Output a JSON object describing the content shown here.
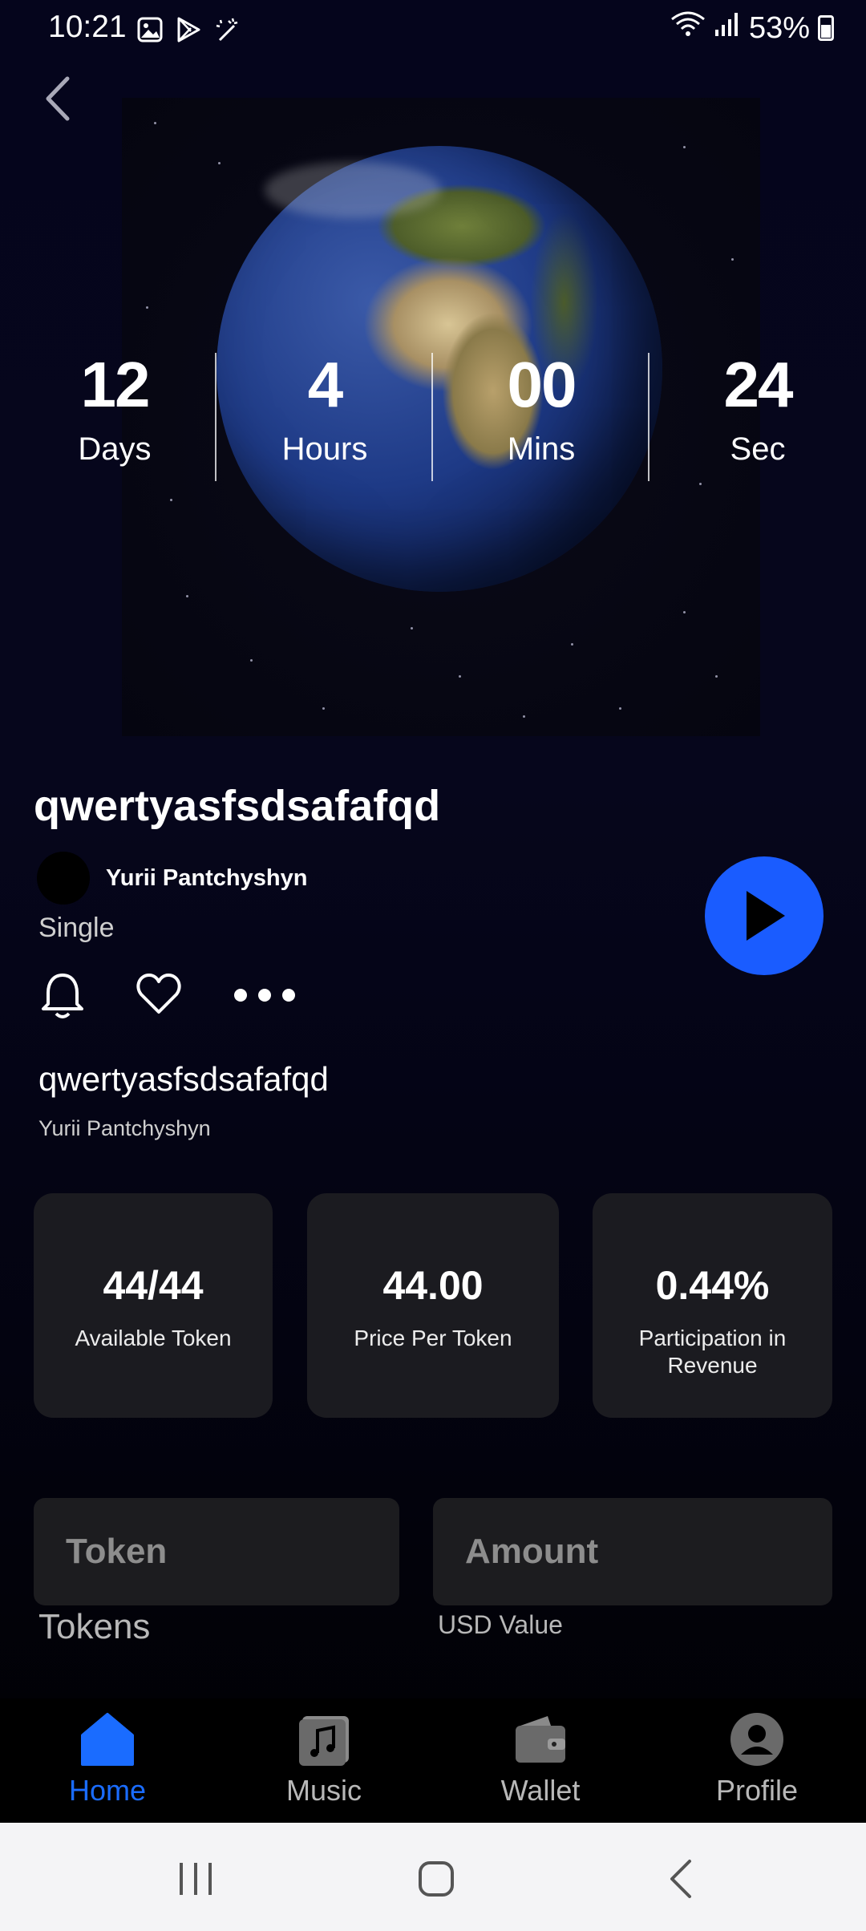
{
  "status": {
    "time": "10:21",
    "battery": "53%"
  },
  "countdown": [
    {
      "value": "12",
      "label": "Days"
    },
    {
      "value": "4",
      "label": "Hours"
    },
    {
      "value": "00",
      "label": "Mins"
    },
    {
      "value": "24",
      "label": "Sec"
    }
  ],
  "track": {
    "title": "qwertyasfsdsafafqd",
    "artist": "Yurii Pantchyshyn",
    "type": "Single",
    "subtitle": "qwertyasfsdsafafqd",
    "subartist": "Yurii Pantchyshyn"
  },
  "stats": [
    {
      "value": "44/44",
      "label": "Available Token"
    },
    {
      "value": "44.00",
      "label": "Price Per Token"
    },
    {
      "value": "0.44%",
      "label": "Participation in Revenue"
    }
  ],
  "form": {
    "token_placeholder": "Token",
    "token_caption": "Tokens",
    "amount_placeholder": "Amount",
    "amount_caption": "USD Value"
  },
  "nav": {
    "home": "Home",
    "music": "Music",
    "wallet": "Wallet",
    "profile": "Profile"
  },
  "colors": {
    "accent": "#1a5cff",
    "card_bg": "#1b1b20"
  }
}
